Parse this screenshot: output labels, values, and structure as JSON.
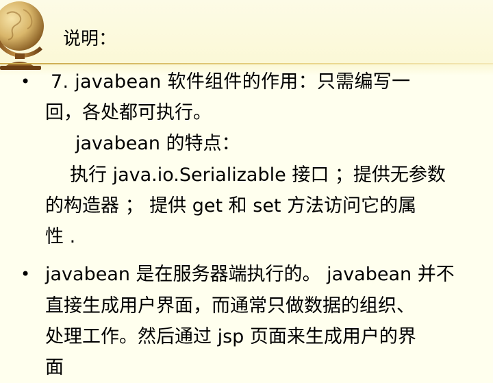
{
  "slide": {
    "title": "说明：",
    "bullet1": {
      "lines": [
        "7.        javabean  软件组件的作用：只需编写一",
        "回，各处都可执行。",
        "javabean 的特点：",
        "执行 java.io.Serializable 接口 ；提供无参数",
        "的构造器 ；  提供 get 和 set 方法访问它的属",
        "性 ."
      ]
    },
    "bullet2": {
      "lines": [
        "javabean 是在服务器端执行的。 javabean 并不",
        "直接生成用户界面，而通常只做数据的组织、",
        "处理工作。然后通过 jsp 页面来生成用户的界",
        "面"
      ]
    },
    "bullet_marker": "•",
    "colors": {
      "background": "#ffffee",
      "divider": "#c9a74a",
      "text": "#000000"
    },
    "icons": [
      "globe-icon"
    ]
  }
}
